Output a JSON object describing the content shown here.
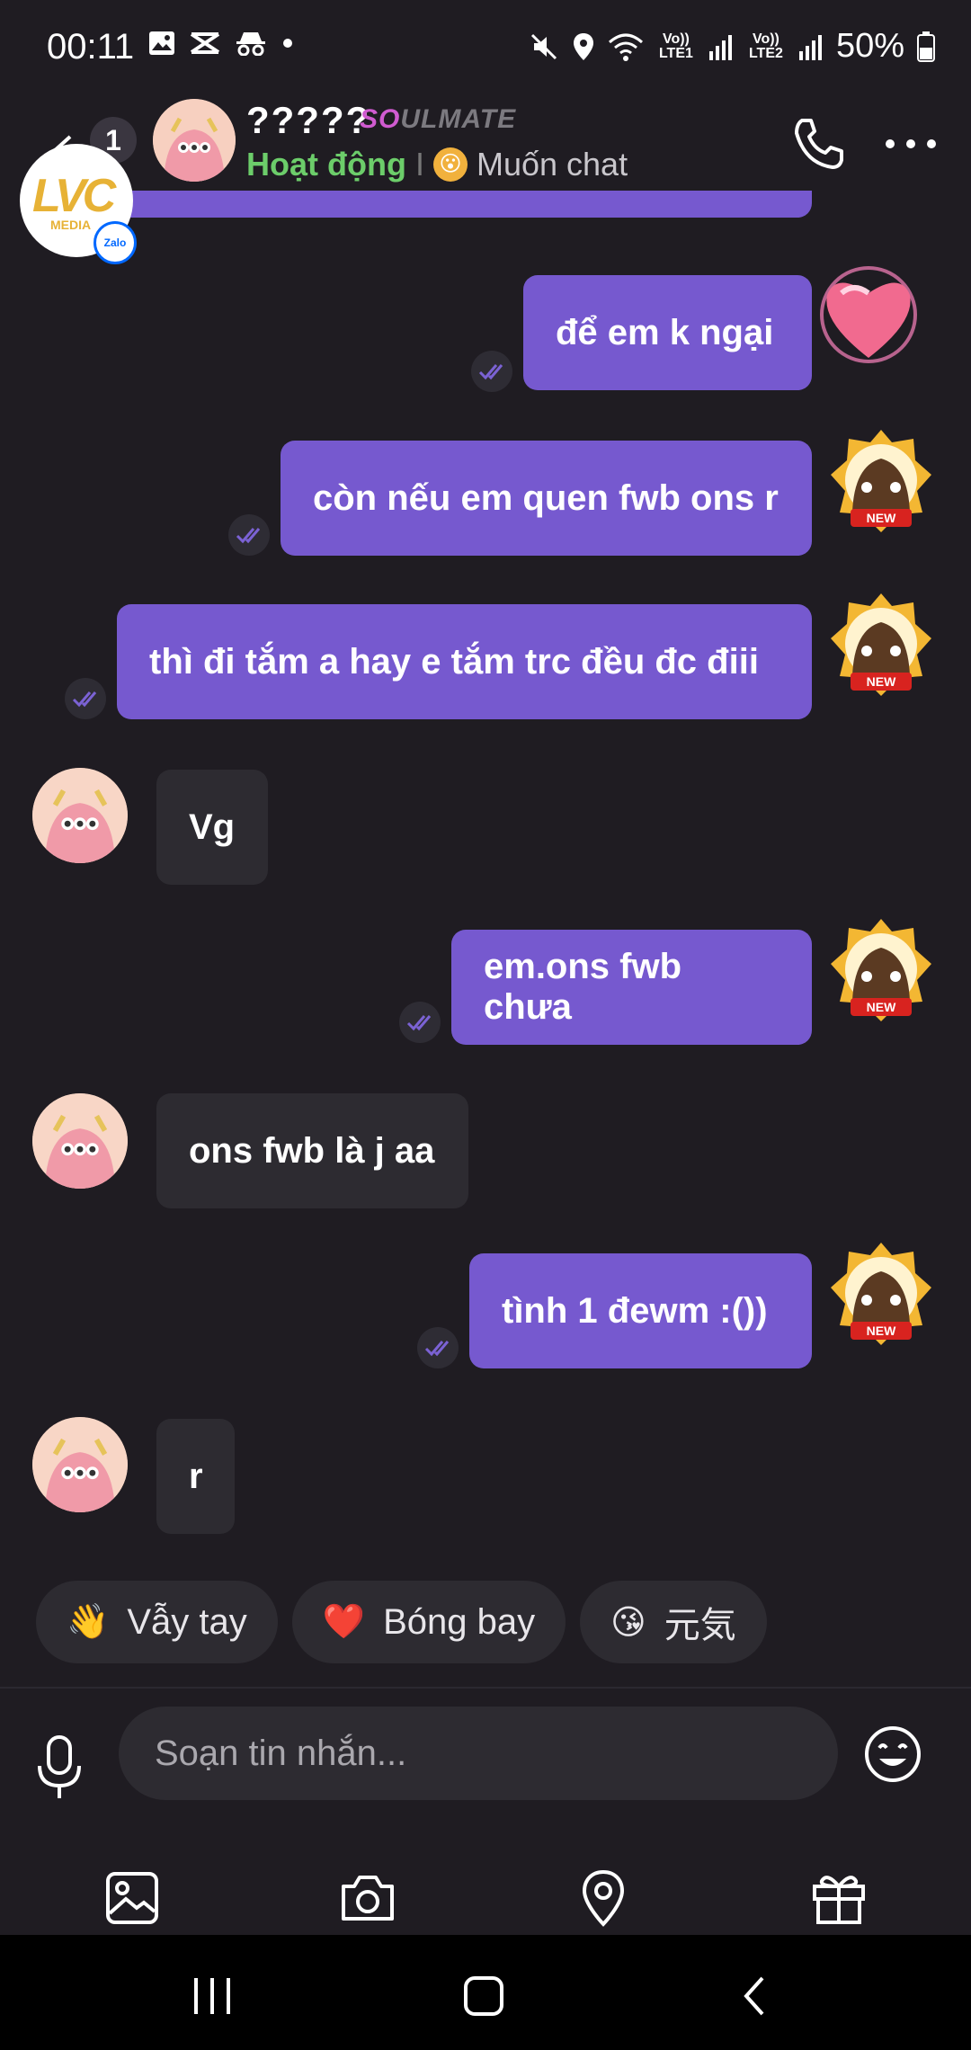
{
  "status_bar": {
    "time": "00:11",
    "net1": "Vo)) LTE1",
    "net2": "Vo)) LTE2",
    "battery": "50%"
  },
  "header": {
    "unread_count": "1",
    "peer_name": "?????",
    "badge_so": "SO",
    "badge_rest": "ULMATE",
    "status": "Hoạt động",
    "separator": "I",
    "mood": "Muốn chat"
  },
  "watermark": {
    "logo_text": "LVC",
    "logo_sub": "MEDIA",
    "zalo": "Zalo"
  },
  "messages": [
    {
      "from": "me",
      "text": "để em k ngại"
    },
    {
      "from": "me",
      "text": "còn nếu em quen fwb ons r"
    },
    {
      "from": "me",
      "text": "thì đi tắm a hay e tắm trc đều đc điii"
    },
    {
      "from": "them",
      "text": "Vg"
    },
    {
      "from": "me",
      "text": "em.ons fwb chưa"
    },
    {
      "from": "them",
      "text": "ons fwb là j aa"
    },
    {
      "from": "me",
      "text": "tình 1 đewm :())"
    },
    {
      "from": "them",
      "text": "r"
    }
  ],
  "quick_replies": [
    {
      "emoji": "👋",
      "label": "Vẫy tay"
    },
    {
      "emoji": "❤️",
      "label": "Bóng bay"
    },
    {
      "emoji": "😘",
      "label": "元気"
    }
  ],
  "composer": {
    "placeholder": "Soạn tin nhắn..."
  },
  "new_badge_text": "NEW",
  "colors": {
    "background": "#1f1c22",
    "my_bubble": "#7659cf",
    "their_bubble": "#2d2b31",
    "online_green": "#6ccd6a"
  }
}
